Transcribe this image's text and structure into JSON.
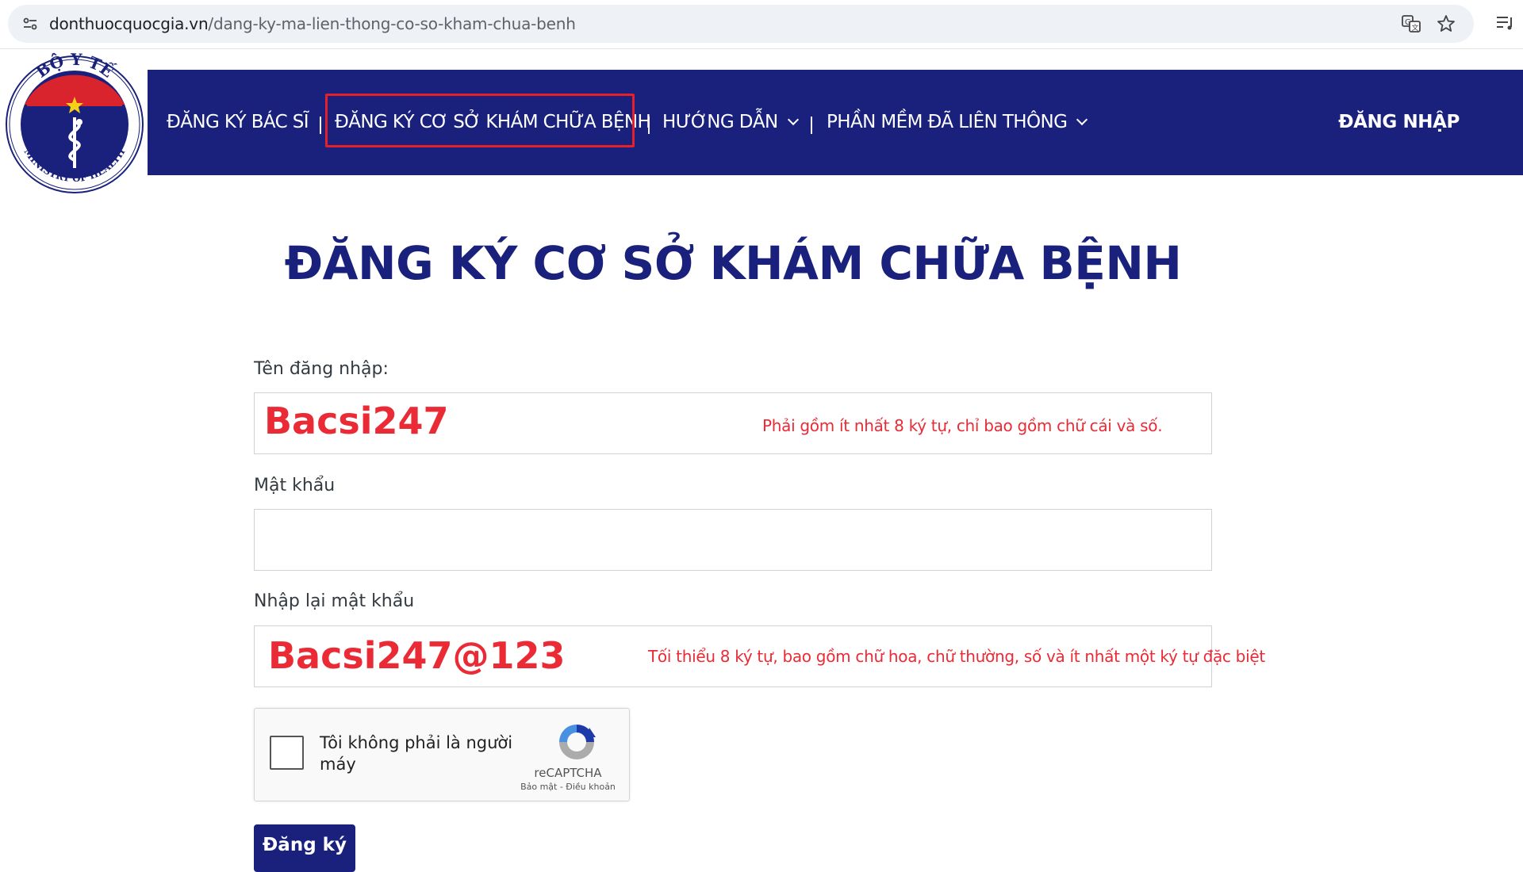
{
  "browser": {
    "url_host": "donthuocquocgia.vn",
    "url_path": "/dang-ky-ma-lien-thong-co-so-kham-chua-benh"
  },
  "logo": {
    "top_text": "BỘ Y TẾ",
    "bottom_text": "MINISTRY OF HEALTH"
  },
  "nav": {
    "items": [
      {
        "label": "ĐĂNG KÝ BÁC SĨ"
      },
      {
        "label": "ĐĂNG KÝ CƠ SỞ KHÁM CHỮA BỆNH"
      },
      {
        "label": "HƯỚNG DẪN"
      },
      {
        "label": "PHẦN MỀM ĐÃ LIÊN THÔNG"
      }
    ],
    "separator": "|",
    "login": "ĐĂNG NHẬP"
  },
  "page": {
    "title": "ĐĂNG KÝ CƠ SỞ KHÁM CHỮA BỆNH"
  },
  "form": {
    "username_label": "Tên đăng nhập:",
    "username_value": "Bacsi247",
    "username_hint": "Phải gồm ít nhất 8 ký tự, chỉ bao gồm chữ cái và số.",
    "password_label": "Mật khẩu",
    "confirm_label": "Nhập lại mật khẩu",
    "confirm_value": "Bacsi247@123",
    "confirm_hint": "Tối thiểu 8 ký tự, bao gồm chữ hoa, chữ thường, số và ít nhất một ký tự đặc biệt",
    "submit": "Đăng ký"
  },
  "recaptcha": {
    "label": "Tôi không phải là người máy",
    "brand": "reCAPTCHA",
    "terms": "Bảo mật - Điều khoản"
  },
  "colors": {
    "nav_bg": "#19217c",
    "highlight": "#e5202a",
    "annotation": "#ea2b36"
  }
}
